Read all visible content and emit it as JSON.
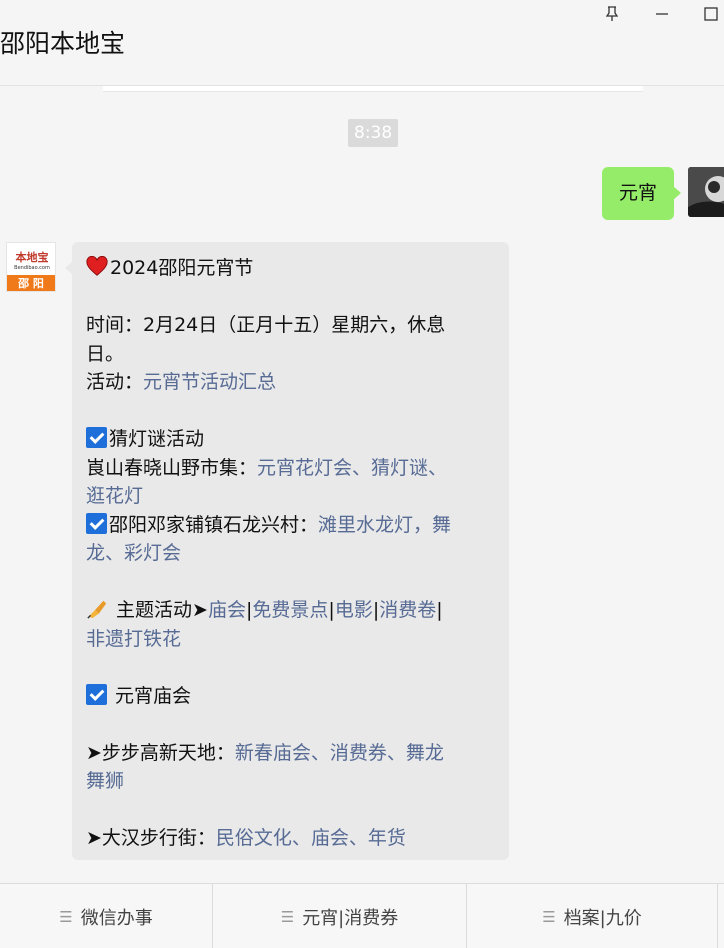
{
  "window": {
    "title": "邵阳本地宝"
  },
  "chat": {
    "timestamp": "8:38",
    "outgoing": {
      "text": "元宵"
    },
    "incoming": {
      "avatar": {
        "brand": "本地宝",
        "sub": "Bendibao.com",
        "city": "邵 阳"
      },
      "heading": "2024邵阳元宵节",
      "time_label": "时间：2月24日（正月十五）星期六，休息",
      "time_label_2": "日。",
      "activity_label": "活动：",
      "activity_link": "元宵节活动汇总",
      "section1_title": "猜灯谜活动",
      "section1_line_label": "崀山春晓山野市集：",
      "section1_line_link_a": "元宵花灯会、猜灯谜、",
      "section1_line_link_b": "逛花灯",
      "section2_label": "邵阳邓家铺镇石龙兴村：",
      "section2_link_a": "滩里水龙灯，舞",
      "section2_link_b": "龙、彩灯会",
      "theme_label": " 主题活动➤",
      "theme_links": [
        "庙会",
        "免费景点",
        "电影",
        "消费卷",
        "非遗打铁花"
      ],
      "theme_sep": "|",
      "temple_fair": " 元宵庙会",
      "line_bubugao_label": "➤步步高新天地：",
      "line_bubugao_link_a": "新春庙会、消费券、舞龙",
      "line_bubugao_link_b": "舞狮",
      "line_dahan_label": "➤大汉步行街：",
      "line_dahan_link": "民俗文化、庙会、年货"
    }
  },
  "menu": {
    "items": [
      {
        "label": "微信办事",
        "icon": "menu-icon"
      },
      {
        "label": "元宵|消费券",
        "icon": "menu-icon"
      },
      {
        "label": "档案|九价",
        "icon": "menu-icon"
      }
    ]
  },
  "colors": {
    "link": "#576b95",
    "outgoing_bubble": "#95ec69",
    "incoming_bubble": "#e9e9e9",
    "checkbox": "#1e6fd9"
  }
}
